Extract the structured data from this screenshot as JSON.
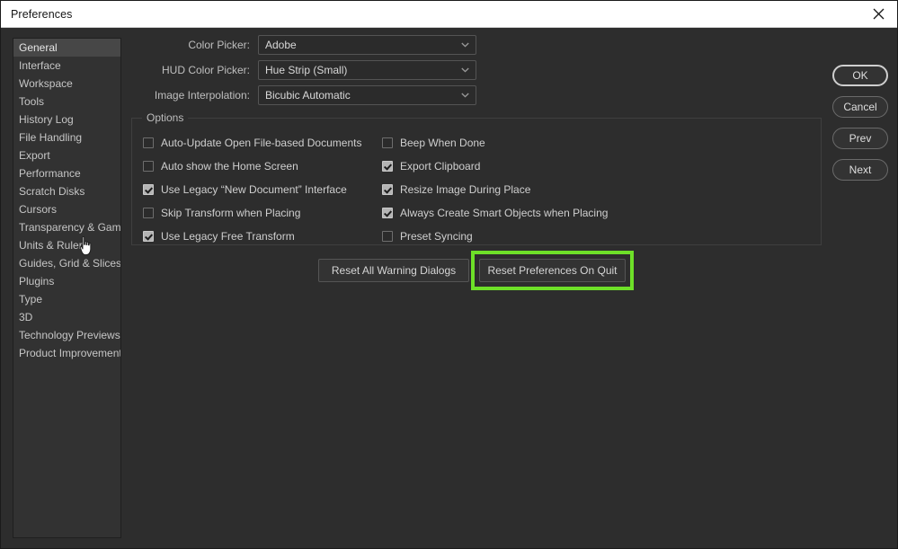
{
  "window": {
    "title": "Preferences",
    "close_icon": "close-x-icon"
  },
  "sidebar": {
    "items": [
      {
        "label": "General",
        "selected": true
      },
      {
        "label": "Interface",
        "selected": false
      },
      {
        "label": "Workspace",
        "selected": false
      },
      {
        "label": "Tools",
        "selected": false
      },
      {
        "label": "History Log",
        "selected": false
      },
      {
        "label": "File Handling",
        "selected": false
      },
      {
        "label": "Export",
        "selected": false
      },
      {
        "label": "Performance",
        "selected": false
      },
      {
        "label": "Scratch Disks",
        "selected": false
      },
      {
        "label": "Cursors",
        "selected": false
      },
      {
        "label": "Transparency & Gamut",
        "selected": false
      },
      {
        "label": "Units & Rulers",
        "selected": false
      },
      {
        "label": "Guides, Grid & Slices",
        "selected": false
      },
      {
        "label": "Plugins",
        "selected": false
      },
      {
        "label": "Type",
        "selected": false
      },
      {
        "label": "3D",
        "selected": false
      },
      {
        "label": "Technology Previews",
        "selected": false
      },
      {
        "label": "Product Improvement",
        "selected": false
      }
    ]
  },
  "fields": [
    {
      "label": "Color Picker:",
      "value": "Adobe",
      "icon": "chevron-down-icon"
    },
    {
      "label": "HUD Color Picker:",
      "value": "Hue Strip (Small)",
      "icon": "chevron-down-icon"
    },
    {
      "label": "Image Interpolation:",
      "value": "Bicubic Automatic",
      "icon": "chevron-down-icon"
    }
  ],
  "options_group": {
    "title": "Options",
    "left_column": [
      {
        "label": "Auto-Update Open File-based Documents",
        "checked": false
      },
      {
        "label": "Auto show the Home Screen",
        "checked": false
      },
      {
        "label": "Use Legacy “New Document” Interface",
        "checked": true
      },
      {
        "label": "Skip Transform when Placing",
        "checked": false
      },
      {
        "label": "Use Legacy Free Transform",
        "checked": true
      }
    ],
    "right_column": [
      {
        "label": "Beep When Done",
        "checked": false
      },
      {
        "label": "Export Clipboard",
        "checked": true
      },
      {
        "label": "Resize Image During Place",
        "checked": true
      },
      {
        "label": "Always Create Smart Objects when Placing",
        "checked": true
      },
      {
        "label": "Preset Syncing",
        "checked": false
      }
    ]
  },
  "reset_buttons": [
    {
      "label": "Reset All Warning Dialogs",
      "highlighted": false
    },
    {
      "label": "Reset Preferences On Quit",
      "highlighted": true
    }
  ],
  "action_buttons": [
    {
      "label": "OK",
      "primary": true
    },
    {
      "label": "Cancel",
      "primary": false
    },
    {
      "label": "Prev",
      "primary": false
    },
    {
      "label": "Next",
      "primary": false
    }
  ],
  "colors": {
    "highlight_green": "#6ee028",
    "dialog_background": "#2d2d2d",
    "titlebar_background": "#ffffff",
    "selected_item": "#474747"
  },
  "cursor": {
    "icon": "pointing-hand-cursor"
  }
}
